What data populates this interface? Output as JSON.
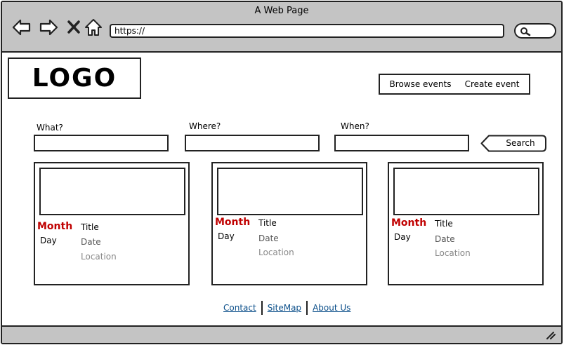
{
  "window": {
    "title": "A Web Page"
  },
  "toolbar": {
    "url": "https://",
    "back_icon": "arrow-left-icon",
    "forward_icon": "arrow-right-icon",
    "stop_icon": "close-icon",
    "home_icon": "home-icon",
    "search_icon": "search-icon"
  },
  "header": {
    "logo": "LOGO",
    "nav": [
      "Browse events",
      "Create event"
    ]
  },
  "search": {
    "what_label": "What?",
    "where_label": "Where?",
    "when_label": "When?",
    "button_label": "Search"
  },
  "events": [
    {
      "month": "Month",
      "day": "Day",
      "title": "Title",
      "date": "Date",
      "location": "Location"
    },
    {
      "month": "Month",
      "day": "Day",
      "title": "Title",
      "date": "Date",
      "location": "Location"
    },
    {
      "month": "Month",
      "day": "Day",
      "title": "Title",
      "date": "Date",
      "location": "Location"
    }
  ],
  "footer": {
    "links": [
      "Contact",
      "SiteMap",
      "About Us"
    ]
  },
  "colors": {
    "chrome": "#c4c4c4",
    "month": "#c00000",
    "link": "#0b4f8a"
  }
}
